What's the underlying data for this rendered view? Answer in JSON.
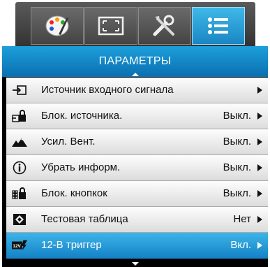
{
  "tabs": [
    {
      "icon": "palette-icon",
      "active": false
    },
    {
      "icon": "screen-fit-icon",
      "active": false
    },
    {
      "icon": "tools-icon",
      "active": false
    },
    {
      "icon": "list-icon",
      "active": true
    }
  ],
  "menu": {
    "title": "ПАРАМЕТРЫ",
    "items": [
      {
        "icon": "input-source-icon",
        "label": "Источник входного сигнала",
        "value": ""
      },
      {
        "icon": "source-lock-icon",
        "label": "Блок. источника.",
        "value": "Выкл."
      },
      {
        "icon": "high-altitude-icon",
        "label": "Усил. Вент.",
        "value": "Выкл."
      },
      {
        "icon": "info-icon",
        "label": "Убрать информ.",
        "value": "Выкл."
      },
      {
        "icon": "keypad-lock-icon",
        "label": "Блок. кнопкок",
        "value": "Выкл."
      },
      {
        "icon": "test-pattern-icon",
        "label": "Тестовая таблица",
        "value": "Нет"
      },
      {
        "icon": "trigger-12v-icon",
        "label": "12-В триггер",
        "value": "Вкл.",
        "selected": true
      }
    ]
  },
  "colors": {
    "accent": "#1d9fdb",
    "selected": "#1582c6",
    "panel_bg": "#000000",
    "row_bg": "#f0f0f0"
  }
}
